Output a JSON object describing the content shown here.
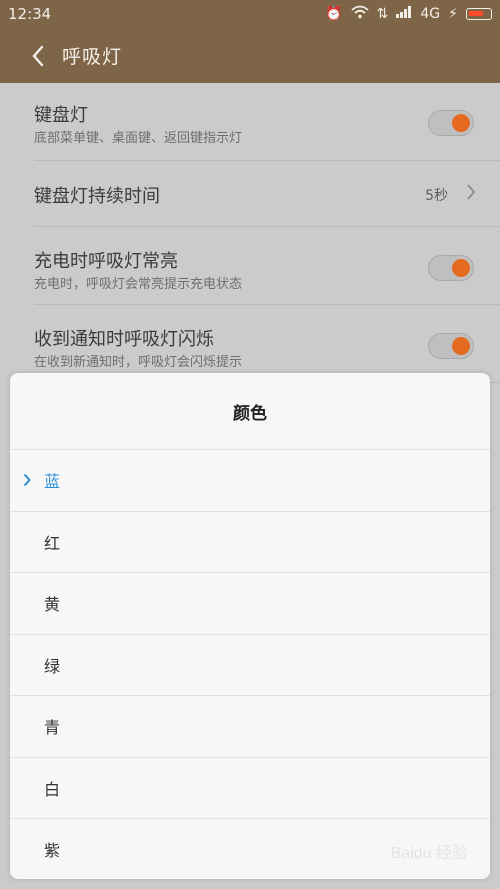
{
  "status_bar": {
    "time": "12:34",
    "network": "4G"
  },
  "header": {
    "title": "呼吸灯"
  },
  "settings": [
    {
      "label": "键盘灯",
      "desc": "底部菜单键、桌面键、返回键指示灯",
      "toggle": true
    },
    {
      "label": "键盘灯持续时间",
      "value": "5秒"
    },
    {
      "label": "充电时呼吸灯常亮",
      "desc": "充电时，呼吸灯会常亮提示充电状态",
      "toggle": true
    },
    {
      "label": "收到通知时呼吸灯闪烁",
      "desc": "在收到新通知时，呼吸灯会闪烁提示",
      "toggle": true
    }
  ],
  "dialog": {
    "title": "颜色",
    "options": [
      "蓝",
      "红",
      "黄",
      "绿",
      "青",
      "白",
      "紫"
    ],
    "selected": "蓝"
  },
  "colors": {
    "accent": "#2f8fd7",
    "toggle_on": "#e46a1f",
    "header_bg": "#7e6548"
  },
  "watermark": "Baidu 经验"
}
